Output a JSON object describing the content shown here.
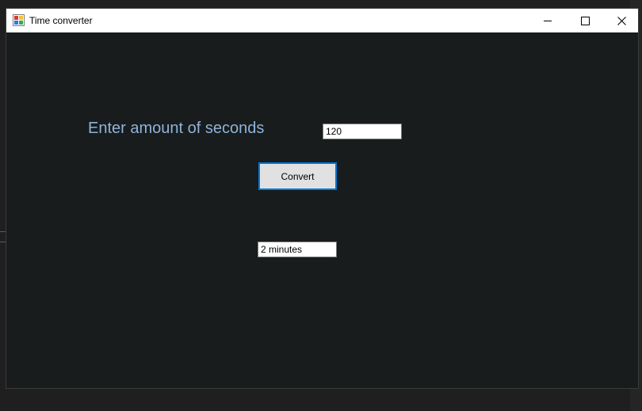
{
  "window": {
    "title": "Time converter",
    "icon": "winforms-app-icon",
    "controls": {
      "minimize_icon": "minimize-icon",
      "maximize_icon": "maximize-icon",
      "close_icon": "close-icon"
    }
  },
  "form": {
    "prompt_label": "Enter amount of seconds",
    "seconds_value": "120",
    "convert_label": "Convert",
    "result_value": "2 minutes"
  },
  "colors": {
    "client_background": "#181c1c",
    "label_text": "#8fb3d9",
    "button_focus_border": "#0078d7",
    "button_face": "#e1e1e1"
  }
}
